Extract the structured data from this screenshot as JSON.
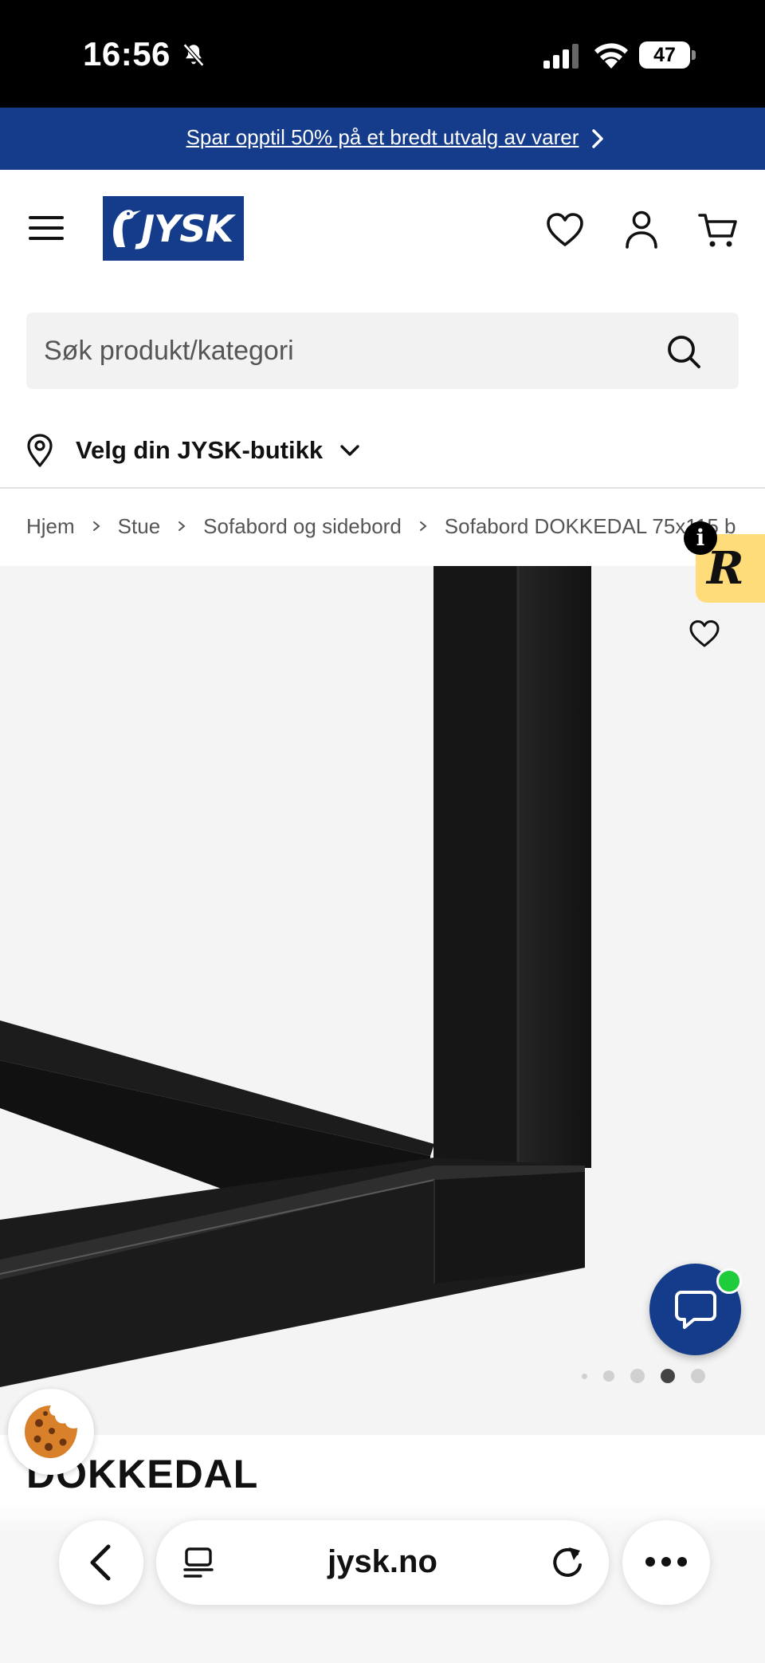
{
  "status_bar": {
    "time": "16:56",
    "battery_level": "47",
    "icons": [
      "bell-slash-icon",
      "signal-icon",
      "wifi-icon",
      "battery-icon"
    ]
  },
  "promo": {
    "text": "Spar opptil 50% på et bredt utvalg av varer",
    "icon": "chevron-right-icon"
  },
  "header": {
    "logo_text": "JYSK",
    "brand_color": "#143c8a",
    "icons": [
      "menu-icon",
      "heart-icon",
      "user-icon",
      "cart-icon"
    ]
  },
  "search": {
    "placeholder": "Søk produkt/kategori",
    "value": "",
    "icon": "search-icon"
  },
  "store_selector": {
    "label": "Velg din JYSK-butikk",
    "icons": [
      "location-pin-icon",
      "chevron-down-icon"
    ]
  },
  "breadcrumb": {
    "items": [
      "Hjem",
      "Stue",
      "Sofabord og sidebord",
      "Sofabord DOKKEDAL 75x115 b"
    ]
  },
  "product": {
    "title": "DOKKEDAL",
    "image_alt": "Black metal table frame",
    "reviews_badge_letter": "R",
    "info_badge": "i",
    "carousel": {
      "total": 5,
      "active_index": 3
    }
  },
  "chat": {
    "icon": "chat-bubble-icon",
    "online_color": "#1fcc3c"
  },
  "cookie": {
    "icon": "cookie-icon"
  },
  "browser_bar": {
    "url": "jysk.no",
    "icons": [
      "back-icon",
      "tabs-icon",
      "reload-icon",
      "more-icon"
    ]
  }
}
